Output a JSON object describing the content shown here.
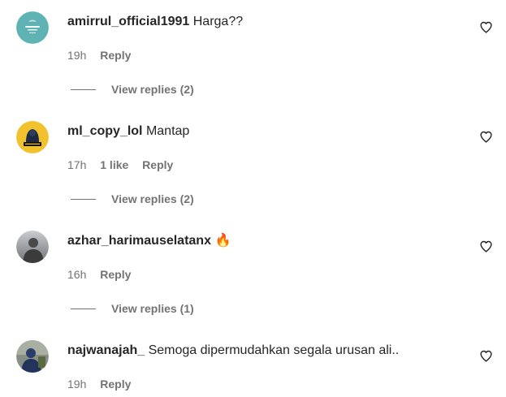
{
  "comments": [
    {
      "username": "amirrul_official1991",
      "text": "Harga??",
      "time": "19h",
      "likes": "",
      "reply_label": "Reply",
      "view_replies": "View replies (2)",
      "avatar": "teal-logo-avatar"
    },
    {
      "username": "ml_copy_lol",
      "text": "Mantap",
      "time": "17h",
      "likes": "1 like",
      "reply_label": "Reply",
      "view_replies": "View replies (2)",
      "avatar": "yellow-gamer-avatar"
    },
    {
      "username": "azhar_harimauselatanx",
      "text": "🔥",
      "time": "16h",
      "likes": "",
      "reply_label": "Reply",
      "view_replies": "View replies (1)",
      "avatar": "person-photo-avatar"
    },
    {
      "username": "najwanajah_",
      "text": "Semoga dipermudahkan segala urusan ali..",
      "time": "19h",
      "likes": "",
      "reply_label": "Reply",
      "view_replies": "",
      "avatar": "person-photo-avatar"
    }
  ],
  "colors": {
    "text": "#262626",
    "secondary": "#737373",
    "fire": "#f25c19"
  },
  "icons": {
    "like": "heart-outline-icon"
  }
}
